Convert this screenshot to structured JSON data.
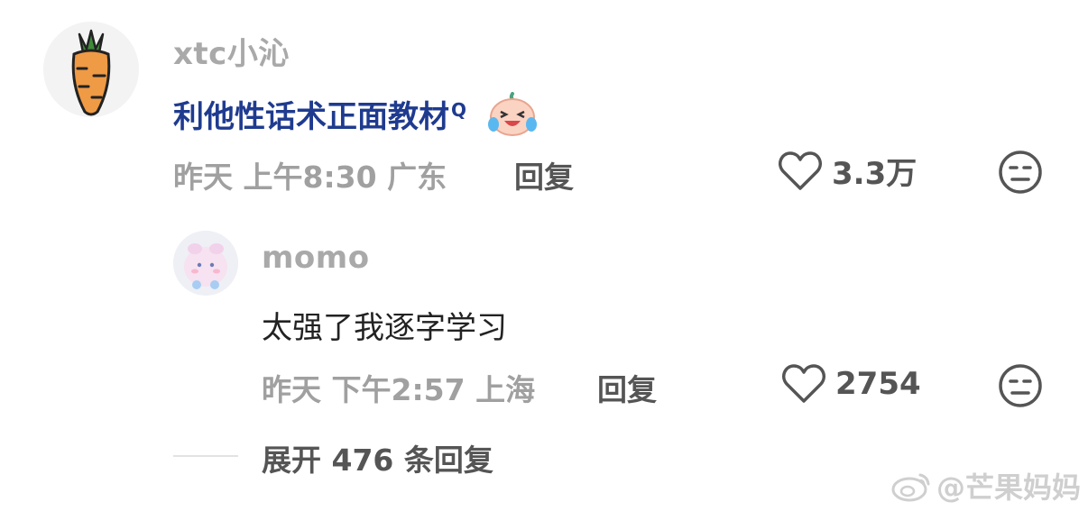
{
  "comment": {
    "username": "xtc小沁",
    "text": "利他性话术正面教材",
    "search_mark": "Q",
    "date": "昨天",
    "time": "上午8:30",
    "location": "广东",
    "reply_label": "回复",
    "likes": "3.3万",
    "avatar_icon": "carrot-icon"
  },
  "reply": {
    "username": "momo",
    "text": "太强了我逐字学习",
    "date": "昨天",
    "time": "下午2:57",
    "location": "上海",
    "reply_label": "回复",
    "likes": "2754",
    "avatar_icon": "cute-character-icon"
  },
  "expand_replies": "展开 476 条回复",
  "watermark": "@芒果妈妈",
  "colors": {
    "link_blue": "#1f3b8f",
    "meta_gray": "#a0a0a0",
    "username_gray": "#a9a9a9"
  }
}
